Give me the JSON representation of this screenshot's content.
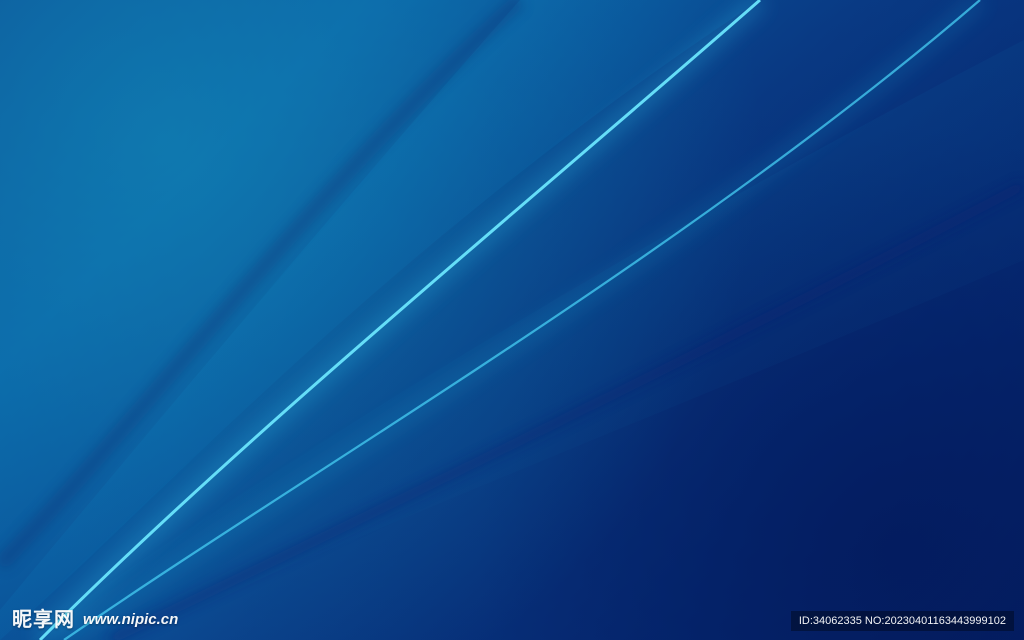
{
  "colors": {
    "background_deep": "#041f63",
    "background_mid": "#0a3e89",
    "highlight_cyan": "#39d7ff",
    "secondary_cyan": "#1cb9e8",
    "shadow_navy": "#0a1f70"
  },
  "watermark": {
    "logo_text": "昵享网",
    "site_text": "www.nipic.cn",
    "id_text": "ID:34062335 NO:20230401163443999102"
  }
}
